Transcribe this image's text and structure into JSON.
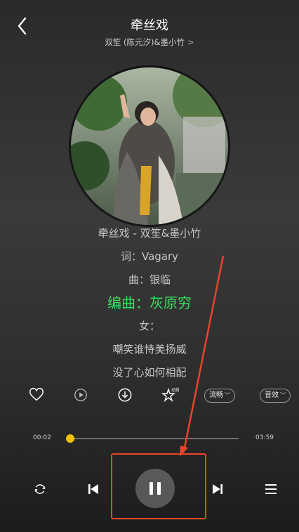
{
  "header": {
    "title": "牵丝戏",
    "artist": "双笙 (陈元汐)&墨小竹",
    "artist_chevron": ">"
  },
  "lyrics": {
    "lines": [
      "牵丝戏 - 双笙&墨小竹",
      "词：Vagary",
      "曲：银临",
      "编曲：灰原穷",
      "女：",
      "嘲笑谁恃美扬威",
      "没了心如何相配"
    ],
    "active_index": 3
  },
  "actions": {
    "quality_label": "流畅",
    "effect_label": "音效",
    "effect_icon_badge": "动效"
  },
  "progress": {
    "current": "00:02",
    "duration": "03:59",
    "fraction": 0.01
  },
  "colors": {
    "active_lyric": "#37e05f",
    "progress": "#f2c200",
    "annotation": "#e8452a"
  },
  "icons": [
    "back-arrow-icon",
    "heart-icon",
    "video-icon",
    "download-icon",
    "star-effect-icon",
    "repeat-icon",
    "previous-icon",
    "pause-icon",
    "next-icon",
    "playlist-icon"
  ]
}
